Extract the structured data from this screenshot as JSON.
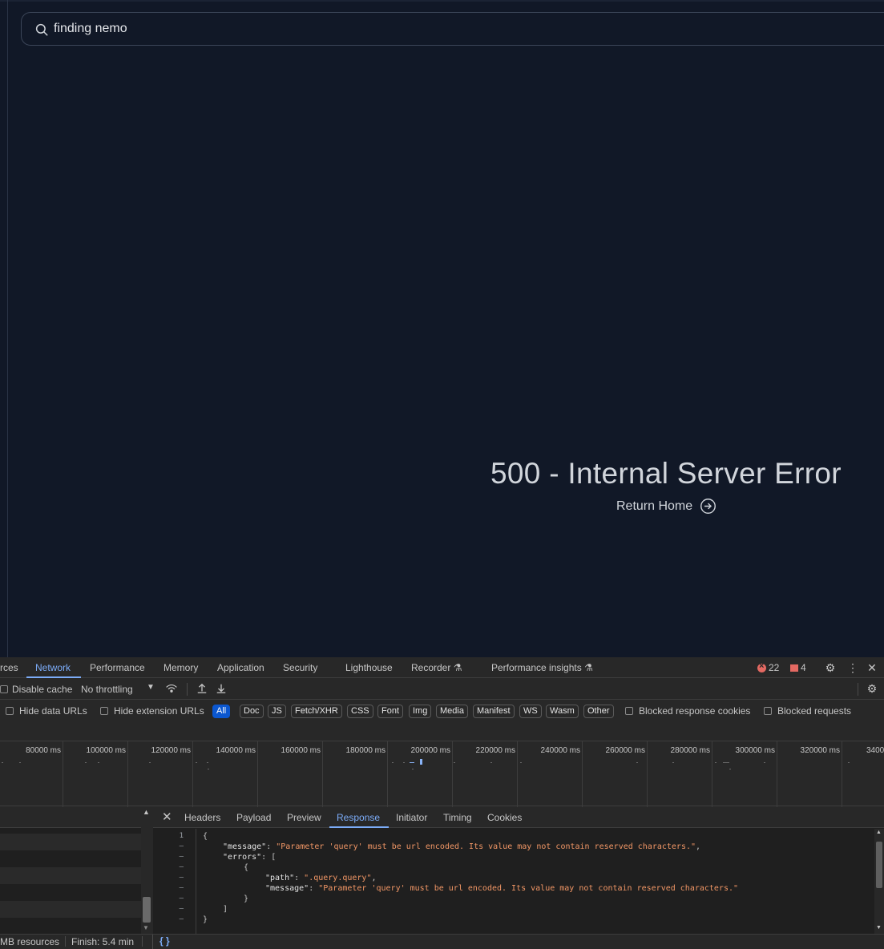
{
  "page": {
    "search_value": "finding nemo",
    "error_title": "500 - Internal Server Error",
    "return_home": "Return Home"
  },
  "devtools": {
    "tabs": [
      "rces",
      "Network",
      "Performance",
      "Memory",
      "Application",
      "Security",
      "Lighthouse",
      "Recorder",
      "Performance insights"
    ],
    "active_tab": "Network",
    "error_count": "22",
    "issue_count": "4",
    "toolbar1": {
      "disable_cache": "Disable cache",
      "throttling": "No throttling"
    },
    "toolbar2": {
      "hide_data_urls": "Hide data URLs",
      "hide_extension_urls": "Hide extension URLs",
      "filters": [
        "All",
        "Doc",
        "JS",
        "Fetch/XHR",
        "CSS",
        "Font",
        "Img",
        "Media",
        "Manifest",
        "WS",
        "Wasm",
        "Other"
      ],
      "active_filter": "All",
      "blocked_response_cookies": "Blocked response cookies",
      "blocked_requests": "Blocked requests"
    },
    "timeline_labels": [
      "80000 ms",
      "100000 ms",
      "120000 ms",
      "140000 ms",
      "160000 ms",
      "180000 ms",
      "200000 ms",
      "220000 ms",
      "240000 ms",
      "260000 ms",
      "280000 ms",
      "300000 ms",
      "320000 ms",
      "3400"
    ],
    "detail_tabs": [
      "Headers",
      "Payload",
      "Preview",
      "Response",
      "Initiator",
      "Timing",
      "Cookies"
    ],
    "active_detail_tab": "Response",
    "gutter": [
      "1",
      "–",
      "–",
      "–",
      "–",
      "–",
      "–",
      "–",
      "–"
    ],
    "response": {
      "line1": "{",
      "message_key": "\"message\"",
      "message_val": "\"Parameter 'query' must be url encoded. Its value may not contain reserved characters.\"",
      "errors_key": "\"errors\"",
      "open_bracket": "[",
      "open_brace": "{",
      "path_key": "\"path\"",
      "path_val": "\".query.query\"",
      "inner_message_key": "\"message\"",
      "inner_message_val": "\"Parameter 'query' must be url encoded. Its value may not contain reserved characters.\"",
      "close_brace": "}",
      "close_bracket": "]",
      "close_root": "}"
    },
    "status": {
      "resources": "MB resources",
      "finish": "Finish: 5.4 min",
      "format_icon": "{ }"
    }
  }
}
